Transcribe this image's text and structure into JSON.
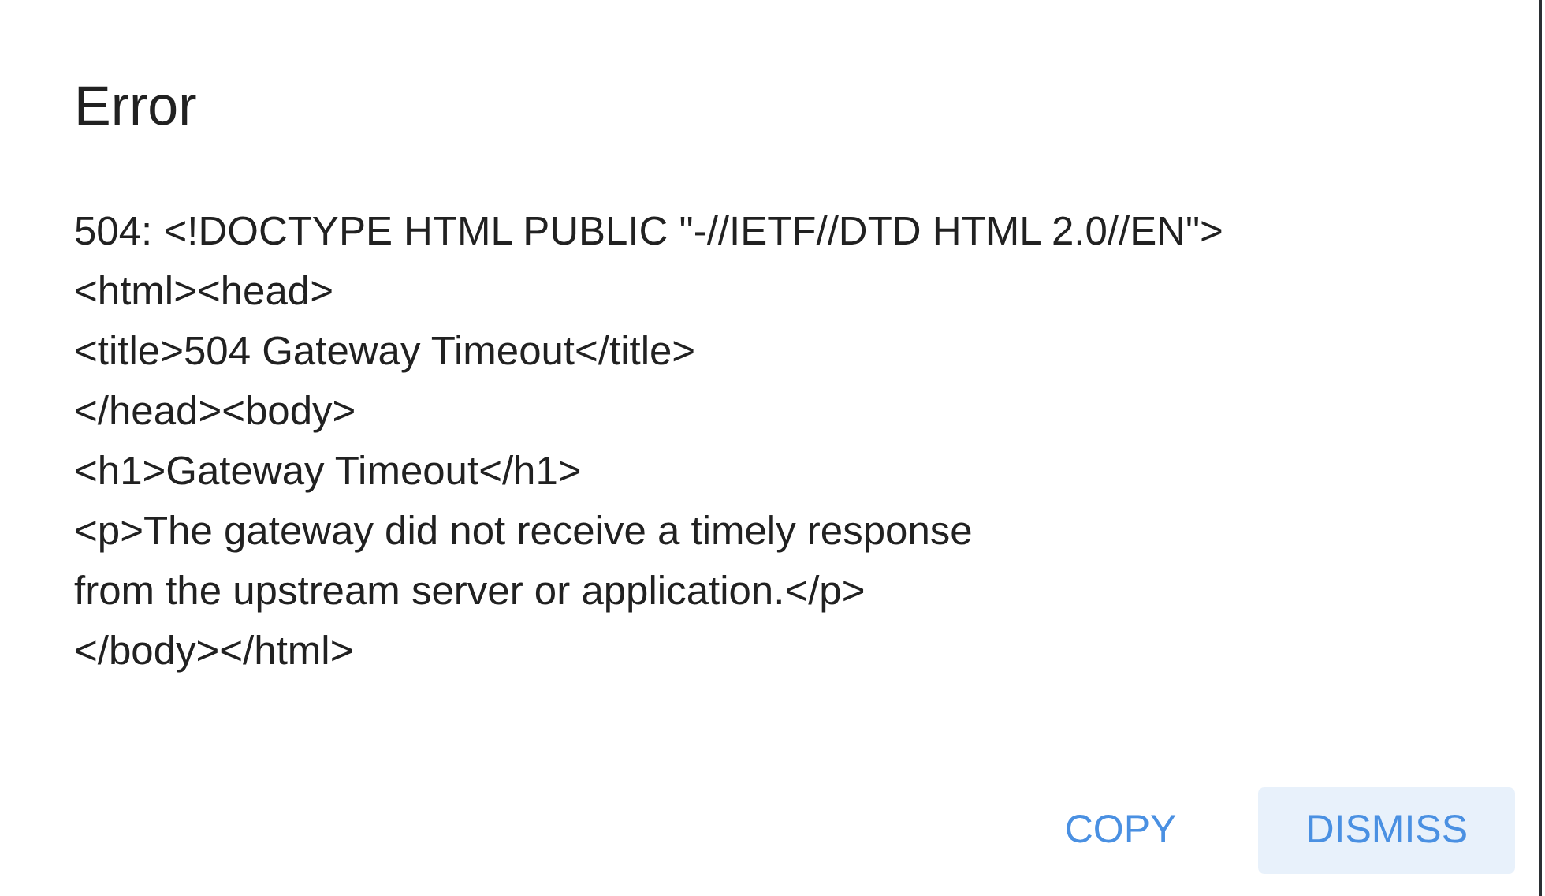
{
  "dialog": {
    "title": "Error",
    "message": "504: <!DOCTYPE HTML PUBLIC \"-//IETF//DTD HTML 2.0//EN\">\n<html><head>\n<title>504 Gateway Timeout</title>\n</head><body>\n<h1>Gateway Timeout</h1>\n<p>The gateway did not receive a timely response\nfrom the upstream server or application.</p>\n</body></html>",
    "buttons": [
      {
        "label": "COPY",
        "focused": false
      },
      {
        "label": "DISMISS",
        "focused": true
      }
    ]
  }
}
